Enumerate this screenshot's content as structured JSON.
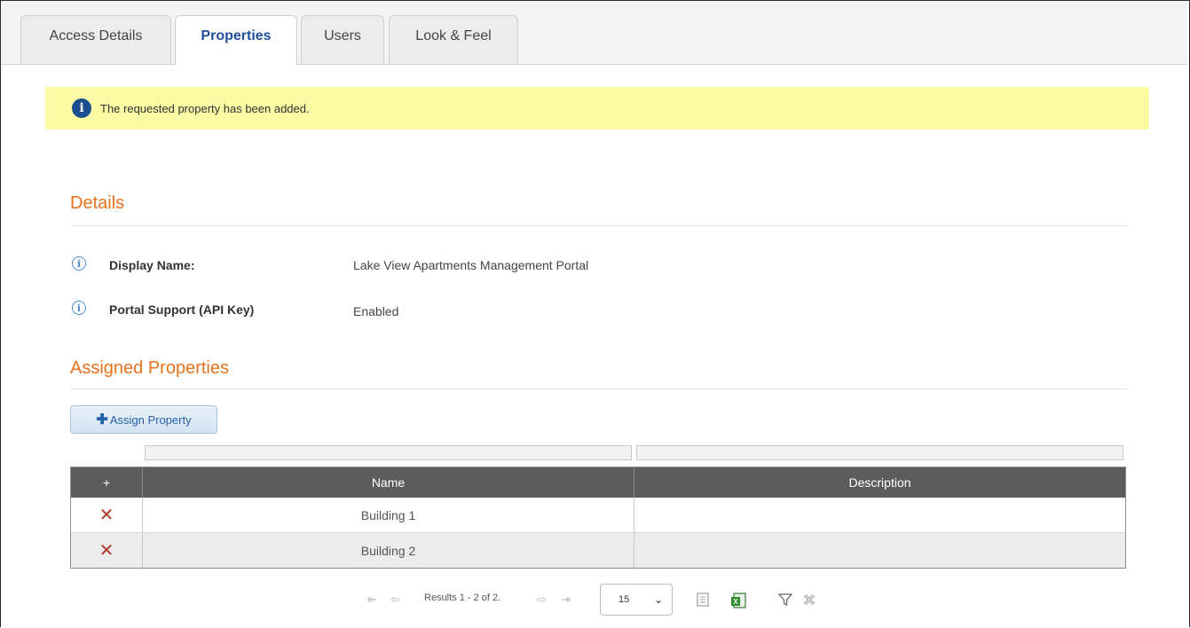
{
  "tabs": [
    {
      "label": "Access Details",
      "active": false
    },
    {
      "label": "Properties",
      "active": true
    },
    {
      "label": "Users",
      "active": false
    },
    {
      "label": "Look & Feel",
      "active": false
    }
  ],
  "alert": {
    "text": "The requested property has been added.",
    "icon": "info-icon"
  },
  "details": {
    "title": "Details",
    "fields": [
      {
        "label": "Display Name:",
        "value": "Lake View Apartments Management Portal"
      },
      {
        "label": "Portal Support (API Key)",
        "value": "Enabled"
      }
    ]
  },
  "assigned": {
    "title": "Assigned Properties",
    "assign_button": "Assign Property",
    "grid": {
      "add_header": "+",
      "columns": [
        "Name",
        "Description"
      ],
      "rows": [
        {
          "name": "Building 1",
          "description": ""
        },
        {
          "name": "Building 2",
          "description": ""
        }
      ]
    },
    "pager": {
      "results": "Results 1 - 2 of 2.",
      "page_size": "15"
    }
  },
  "colors": {
    "accent": "#e8731d",
    "active_tab": "#1f4f9c",
    "alert_bg": "#fbfba6",
    "grid_header": "#5c5c5c",
    "delete": "#b03a2e"
  }
}
